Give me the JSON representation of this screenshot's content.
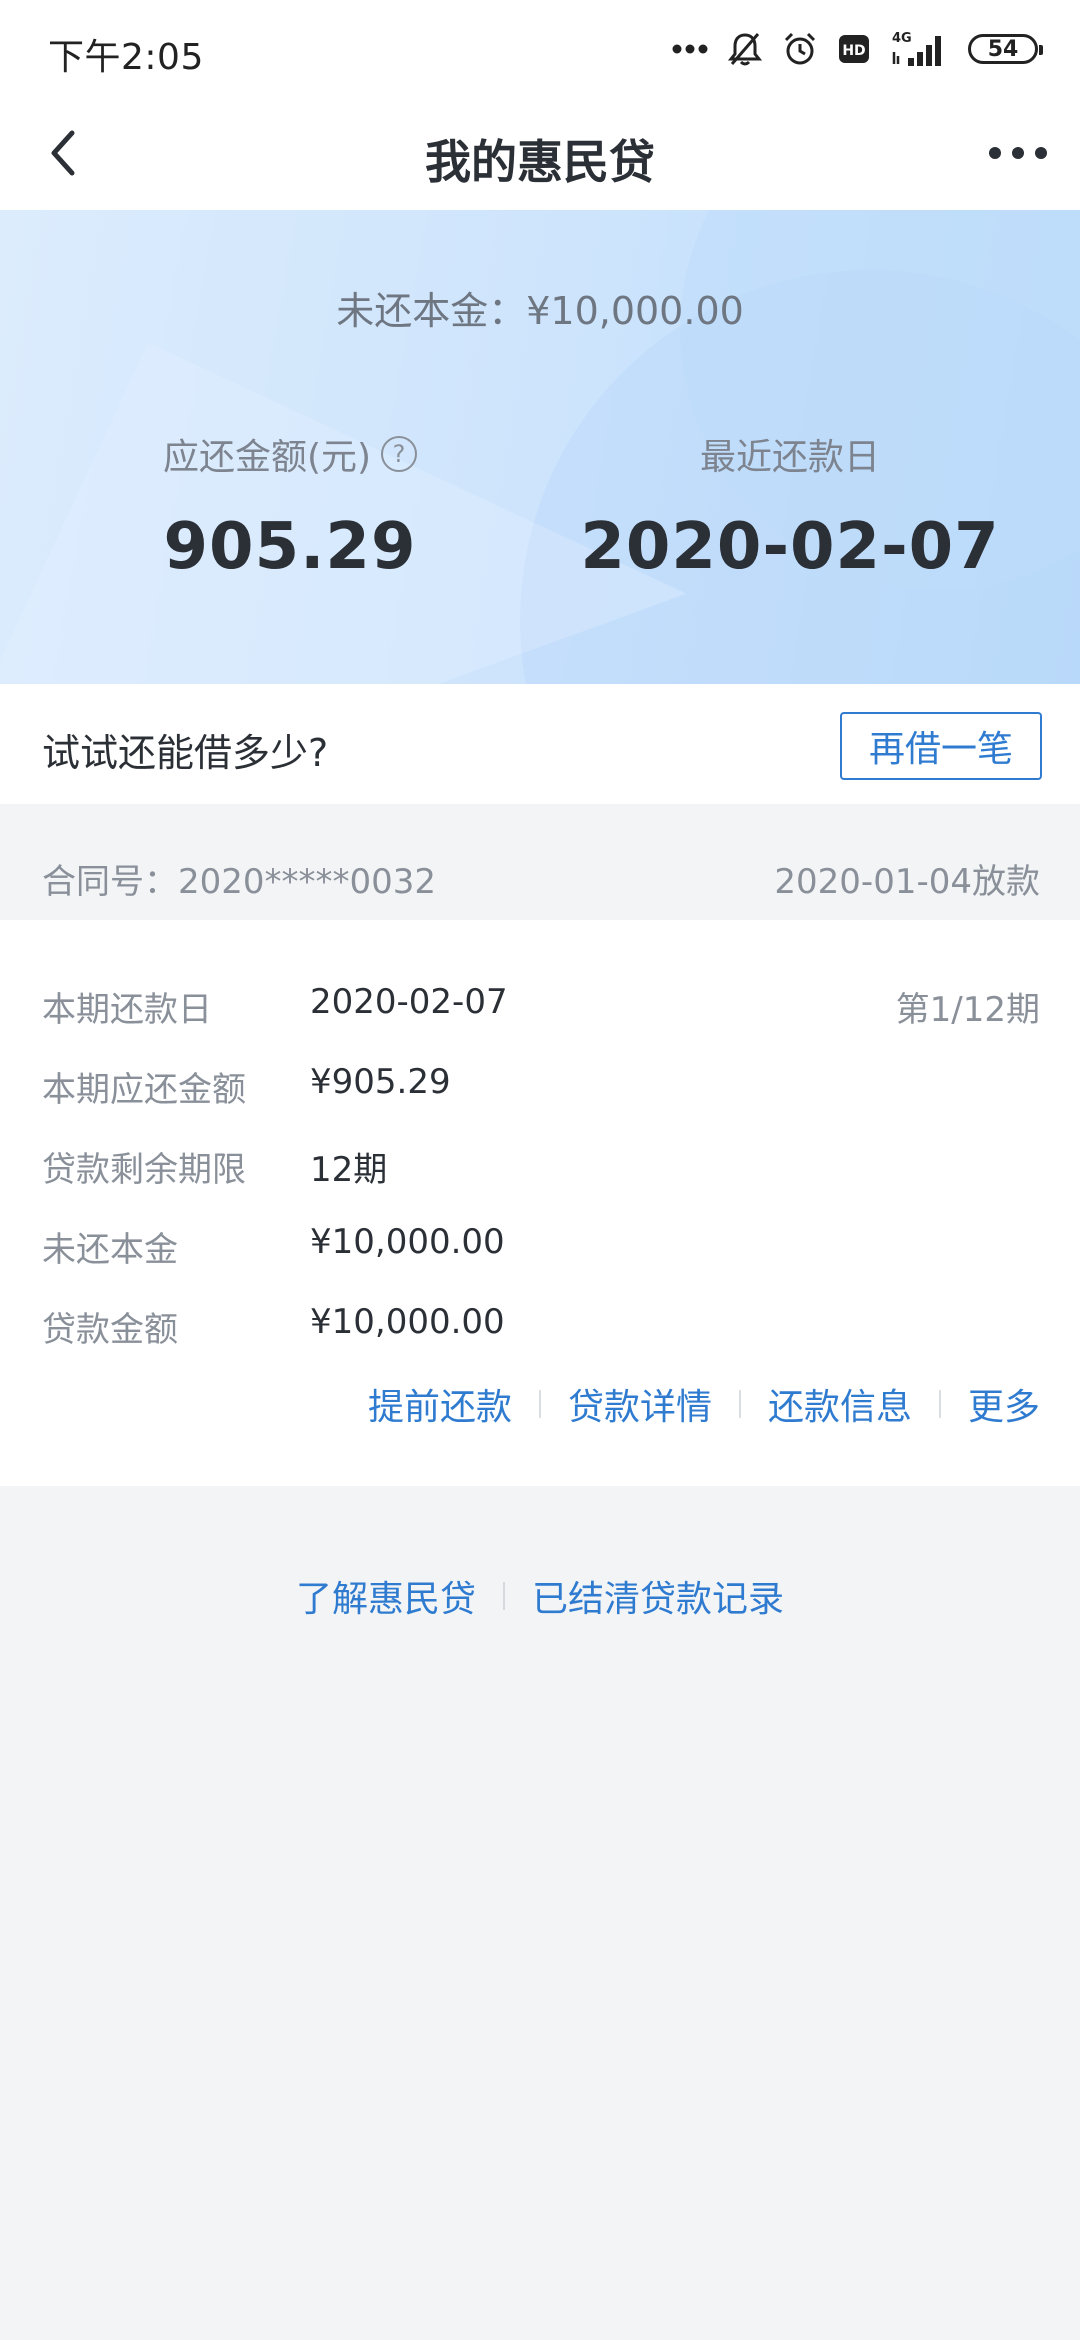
{
  "status_bar": {
    "time": "下午2:05",
    "network": "4G",
    "hd_badge": "HD",
    "battery": "54"
  },
  "nav": {
    "title": "我的惠民贷"
  },
  "hero": {
    "principal_label": "未还本金：",
    "principal_value": "¥10,000.00",
    "due_label": "应还金额(元)",
    "help_glyph": "?",
    "due_value": "905.29",
    "date_label": "最近还款日",
    "date_value": "2020-02-07"
  },
  "promo": {
    "text": "试试还能借多少?",
    "button": "再借一笔"
  },
  "contract": {
    "number": "合同号：2020*****0032",
    "release": "2020-01-04放款"
  },
  "details": {
    "rows": [
      {
        "label": "本期还款日",
        "value": "2020-02-07",
        "extra": "第1/12期"
      },
      {
        "label": "本期应还金额",
        "value": "¥905.29"
      },
      {
        "label": "贷款剩余期限",
        "value": "12期"
      },
      {
        "label": "未还本金",
        "value": "¥10,000.00"
      },
      {
        "label": "贷款金额",
        "value": "¥10,000.00"
      }
    ],
    "links": [
      "提前还款",
      "贷款详情",
      "还款信息",
      "更多"
    ]
  },
  "footer": {
    "links": [
      "了解惠民贷",
      "已结清贷款记录"
    ]
  },
  "colors": {
    "accent": "#2f7bd0",
    "muted": "#8a9099",
    "text": "#2b2f36",
    "hero_bg": "#cfe5fc",
    "page_bg": "#f3f4f6"
  }
}
